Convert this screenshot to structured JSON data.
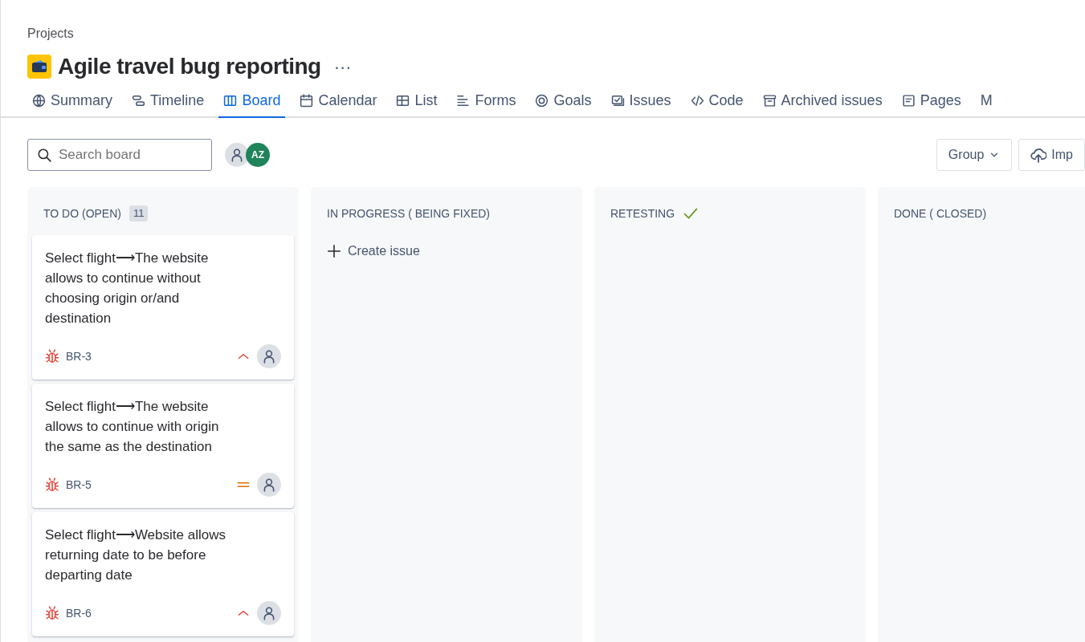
{
  "breadcrumb": "Projects",
  "project": {
    "title": "Agile travel bug reporting",
    "more": "···"
  },
  "tabs": [
    {
      "label": "Summary",
      "selected": false
    },
    {
      "label": "Timeline",
      "selected": false
    },
    {
      "label": "Board",
      "selected": true
    },
    {
      "label": "Calendar",
      "selected": false
    },
    {
      "label": "List",
      "selected": false
    },
    {
      "label": "Forms",
      "selected": false
    },
    {
      "label": "Goals",
      "selected": false
    },
    {
      "label": "Issues",
      "selected": false
    },
    {
      "label": "Code",
      "selected": false
    },
    {
      "label": "Archived issues",
      "selected": false
    },
    {
      "label": "Pages",
      "selected": false
    },
    {
      "label": "M",
      "selected": false
    }
  ],
  "toolbar": {
    "search": {
      "placeholder": "Search board"
    },
    "avatars": [
      {
        "kind": "generic"
      },
      {
        "kind": "initials",
        "initials": "AZ",
        "color": "#1f845a"
      }
    ],
    "buttons": [
      {
        "label": "Group",
        "kind": "dropdown"
      },
      {
        "label": "Imp",
        "kind": "import"
      }
    ]
  },
  "columns": [
    {
      "title": "TO DO (OPEN)",
      "count": "11",
      "done_mark": false,
      "cards": [
        {
          "summary": "Select flight⟶The website allows to continue without choosing origin or/and destination",
          "key": "BR-3",
          "kind": "high"
        },
        {
          "summary": "Select flight⟶The website allows to continue with origin the same as the destination",
          "key": "BR-5",
          "kind": "medium"
        },
        {
          "summary": "Select flight⟶Website allows returning date to be before departing date",
          "key": "BR-6",
          "kind": "high"
        }
      ]
    },
    {
      "title": "IN PROGRESS ( BEING FIXED)",
      "done_mark": false,
      "create_issue": "Create issue"
    },
    {
      "title": "RETESTING",
      "done_mark": true
    },
    {
      "title": "DONE ( CLOSED)",
      "done_mark": false
    }
  ]
}
